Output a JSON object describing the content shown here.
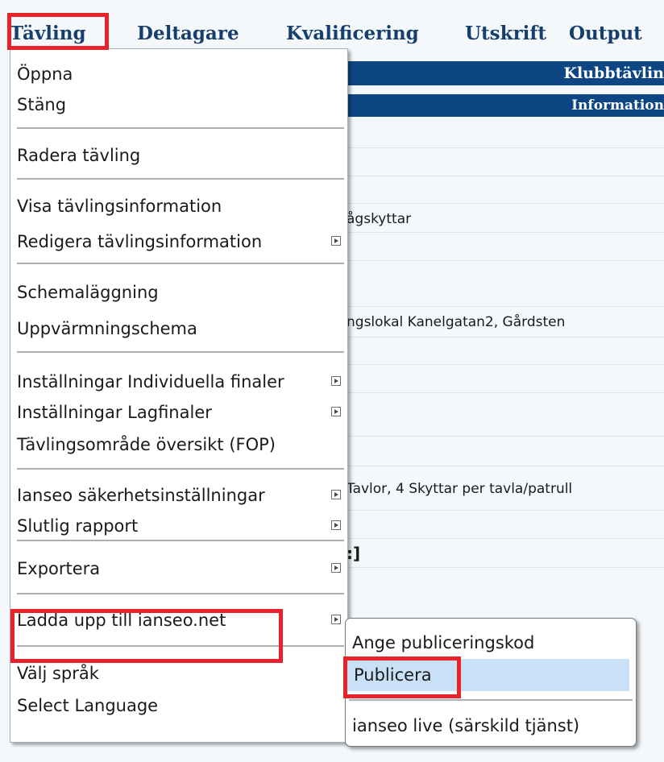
{
  "menubar": {
    "items": [
      "Tävling",
      "Deltagare",
      "Kvalificering",
      "Utskrift",
      "Output"
    ]
  },
  "background": {
    "title_bar": "Klubbtävlin",
    "info_bar": "Information",
    "fragments": [
      "ågskyttar",
      "ngslokal Kanelgatan2, Gårdsten",
      "Tavlor, 4 Skyttar per tavla/patrull",
      ":]"
    ]
  },
  "main_menu": {
    "items": [
      {
        "label": "Öppna",
        "submenu": false
      },
      {
        "label": "Stäng",
        "submenu": false
      },
      {
        "label": "Radera tävling",
        "submenu": false
      },
      {
        "label": "Visa tävlingsinformation",
        "submenu": false
      },
      {
        "label": "Redigera tävlingsinformation",
        "submenu": true
      },
      {
        "label": "Schemaläggning",
        "submenu": false
      },
      {
        "label": "Uppvärmningschema",
        "submenu": false
      },
      {
        "label": "Inställningar Individuella finaler",
        "submenu": true
      },
      {
        "label": "Inställningar Lagfinaler",
        "submenu": true
      },
      {
        "label": "Tävlingsområde översikt (FOP)",
        "submenu": false
      },
      {
        "label": "Ianseo säkerhetsinställningar",
        "submenu": true
      },
      {
        "label": "Slutlig rapport",
        "submenu": true
      },
      {
        "label": "Exportera",
        "submenu": true
      },
      {
        "label": "Ladda upp till ianseo.net",
        "submenu": true
      },
      {
        "label": "Välj språk",
        "submenu": false
      },
      {
        "label": "Select Language",
        "submenu": false
      }
    ]
  },
  "sub_menu": {
    "items": [
      {
        "label": "Ange publiceringskod",
        "selected": false
      },
      {
        "label": "Publicera",
        "selected": true
      },
      {
        "label": "ianseo live (särskild tjänst)",
        "selected": false
      }
    ]
  },
  "colors": {
    "accent_bar": "#0e4583",
    "menubar_text": "#173f6e",
    "highlight_border": "#e8222b",
    "selected_item": "#c9e1f7"
  }
}
